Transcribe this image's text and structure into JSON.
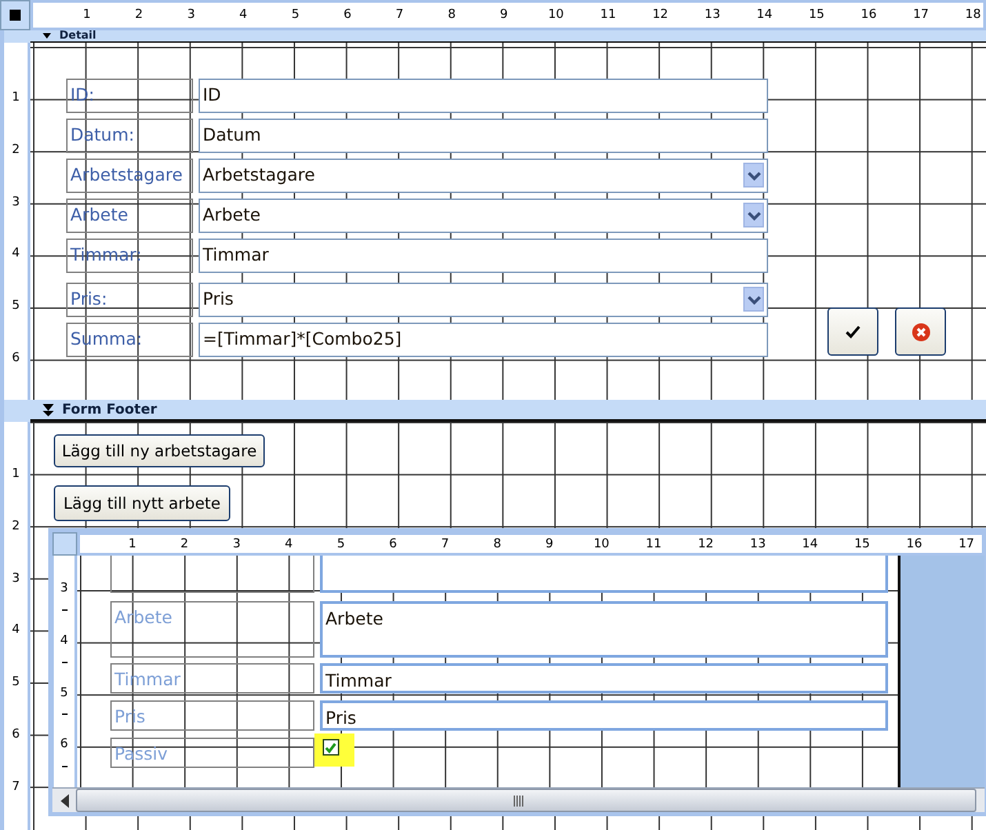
{
  "top_ruler": [
    "1",
    "2",
    "3",
    "4",
    "5",
    "6",
    "7",
    "8",
    "9",
    "10",
    "11",
    "12",
    "13",
    "14",
    "15",
    "16",
    "17",
    "18"
  ],
  "detail": {
    "title": "Detail",
    "ruler": [
      "1",
      "2",
      "3",
      "4",
      "5",
      "6"
    ],
    "fields": [
      {
        "label": "ID:",
        "value": "ID",
        "kind": "textbox"
      },
      {
        "label": "Datum:",
        "value": "Datum",
        "kind": "textbox"
      },
      {
        "label": "Arbetstagare",
        "value": "Arbetstagare",
        "kind": "combo"
      },
      {
        "label": "Arbete",
        "value": "Arbete",
        "kind": "combo"
      },
      {
        "label": "Timmar:",
        "value": "Timmar",
        "kind": "textbox"
      },
      {
        "label": "Pris:",
        "value": "Pris",
        "kind": "combo"
      },
      {
        "label": "Summa:",
        "value": "=[Timmar]*[Combo25]",
        "kind": "textbox"
      }
    ],
    "buttons": [
      {
        "kind": "ok"
      },
      {
        "kind": "cancel"
      }
    ]
  },
  "form_footer": {
    "title": "Form Footer",
    "ruler": [
      "1",
      "2",
      "3",
      "4",
      "5",
      "6",
      "7"
    ],
    "buttons": [
      "Lägg till ny arbetstagare",
      "Lägg till nytt arbete"
    ],
    "subform": {
      "top_ruler": [
        "1",
        "2",
        "3",
        "4",
        "5",
        "6",
        "7",
        "8",
        "9",
        "10",
        "11",
        "12",
        "13",
        "14",
        "15",
        "16",
        "17"
      ],
      "left_ruler": [
        "3",
        "4",
        "5",
        "6"
      ],
      "fields": [
        {
          "label": "Arbete",
          "value": "Arbete",
          "kind": "textbox"
        },
        {
          "label": "Timmar",
          "value": "Timmar",
          "kind": "textbox"
        },
        {
          "label": "Pris",
          "value": "Pris",
          "kind": "textbox"
        },
        {
          "label": "Passiv",
          "kind": "checkbox",
          "checked": true,
          "highlighted": true
        }
      ]
    }
  }
}
